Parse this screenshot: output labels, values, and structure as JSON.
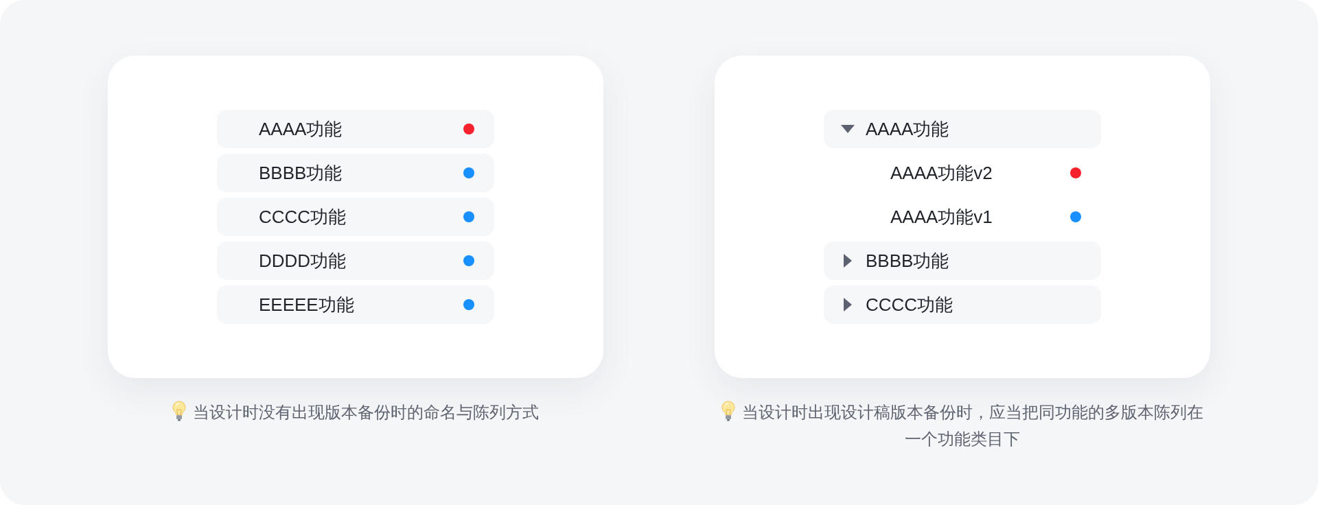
{
  "panels": [
    {
      "kind": "list",
      "items": [
        {
          "label": "AAAA功能",
          "color": "#f5222d"
        },
        {
          "label": "BBBB功能",
          "color": "#1890ff"
        },
        {
          "label": "CCCC功能",
          "color": "#1890ff"
        },
        {
          "label": "DDDD功能",
          "color": "#1890ff"
        },
        {
          "label": "EEEEE功能",
          "color": "#1890ff"
        }
      ],
      "caption": "当设计时没有出现版本备份时的命名与陈列方式"
    },
    {
      "kind": "tree",
      "items": [
        {
          "label": "AAAA功能",
          "expanded": true,
          "children": [
            {
              "label": "AAAA功能v2",
              "color": "#f5222d"
            },
            {
              "label": "AAAA功能v1",
              "color": "#1890ff"
            }
          ]
        },
        {
          "label": "BBBB功能",
          "expanded": false
        },
        {
          "label": "CCCC功能",
          "expanded": false
        }
      ],
      "caption": "当设计时出现设计稿版本备份时，应当把同功能的多版本陈列在一个功能类目下"
    }
  ]
}
